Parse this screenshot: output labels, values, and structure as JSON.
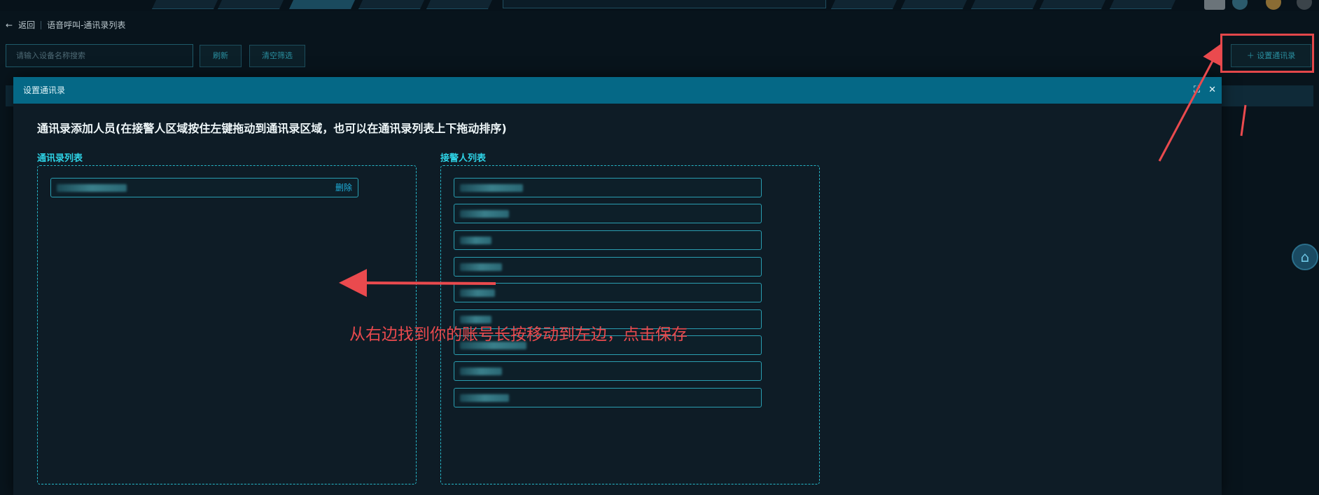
{
  "breadcrumb": {
    "back": "返回",
    "title": "语音呼叫-通讯录列表"
  },
  "search": {
    "placeholder": "请输入设备名称搜索"
  },
  "toolbar": {
    "refresh": "刷新",
    "clear_filter": "清空筛选",
    "set_contacts": "＋ 设置通讯录"
  },
  "dialog": {
    "title": "设置通讯录",
    "instruction": "通讯录添加人员(在接警人区域按住左键拖动到通讯录区域，也可以在通讯录列表上下拖动排序)",
    "contacts_title": "通讯录列表",
    "responders_title": "接警人列表",
    "contacts": [
      {
        "name_widths": 110,
        "delete_label": "删除"
      }
    ],
    "responders": [
      {
        "w": 90
      },
      {
        "w": 70
      },
      {
        "w": 50
      },
      {
        "w": 60
      },
      {
        "w": 55
      },
      {
        "w": 40
      },
      {
        "w": 95
      },
      {
        "w": 60
      },
      {
        "w": 70
      }
    ]
  },
  "annotation": {
    "text": "从右边找到你的账号长按移动到左边，点击保存",
    "color": "#ea4a4e"
  },
  "icons": {
    "maximize": "maximize-icon",
    "close": "close-icon",
    "home": "home-icon"
  }
}
